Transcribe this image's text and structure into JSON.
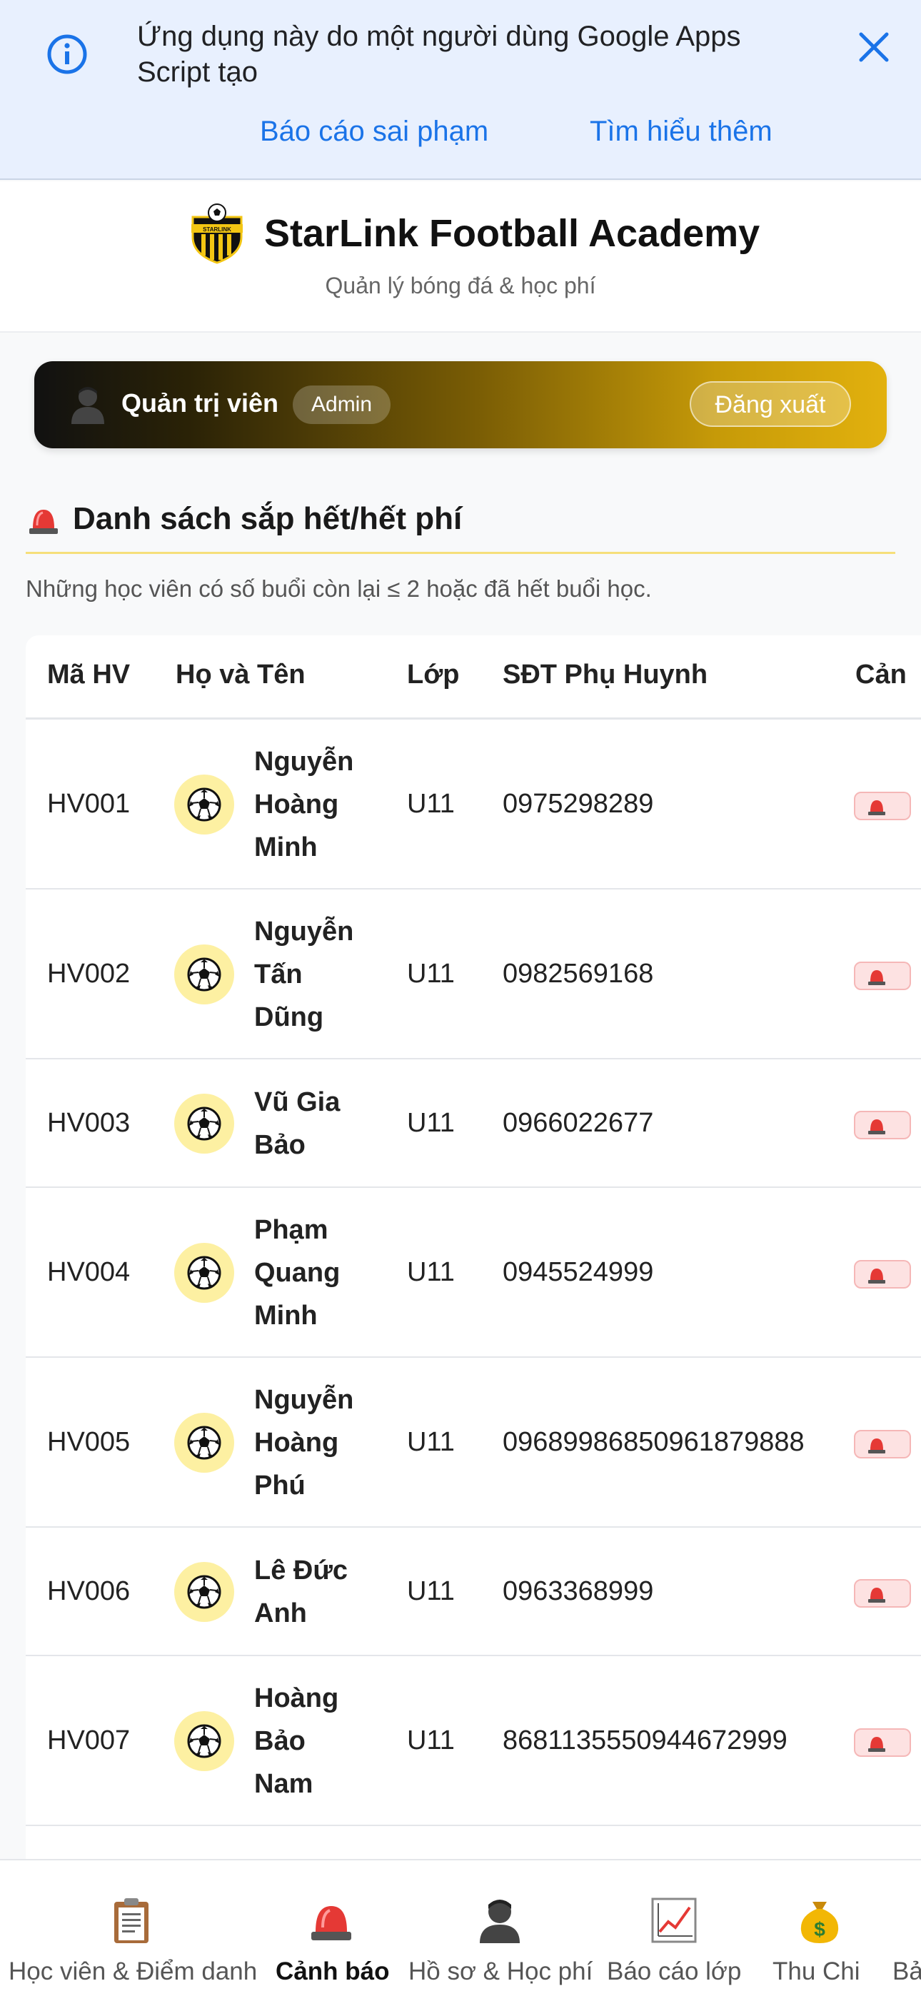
{
  "banner": {
    "text": "Ứng dụng này do một người dùng Google Apps Script tạo",
    "report_link": "Báo cáo sai phạm",
    "learn_link": "Tìm hiểu thêm",
    "info_icon": "info-icon",
    "close_icon": "close-icon",
    "accent": "#1a73e8"
  },
  "header": {
    "logo_text": "STARLINK",
    "title": "StarLink Football Academy",
    "subtitle": "Quản lý bóng đá & học phí"
  },
  "admin": {
    "name": "Quản trị viên",
    "role": "Admin",
    "logout": "Đăng xuất",
    "gradient_end": "#e2b10e"
  },
  "section": {
    "title": "Danh sách sắp hết/hết phí",
    "description": "Những học viên có số buổi còn lại ≤ 2 hoặc đã hết buổi học."
  },
  "table": {
    "columns": [
      "Mã HV",
      "Họ và Tên",
      "Lớp",
      "SĐT Phụ Huynh",
      "Cản"
    ],
    "rows": [
      {
        "id": "HV001",
        "name": [
          "Nguyễn",
          "Hoàng",
          "Minh"
        ],
        "class": "U11",
        "phone": "0975298289"
      },
      {
        "id": "HV002",
        "name": [
          "Nguyễn",
          "Tấn",
          "Dũng"
        ],
        "class": "U11",
        "phone": "0982569168"
      },
      {
        "id": "HV003",
        "name": [
          "Vũ Gia",
          "Bảo"
        ],
        "class": "U11",
        "phone": "0966022677"
      },
      {
        "id": "HV004",
        "name": [
          "Phạm",
          "Quang",
          "Minh"
        ],
        "class": "U11",
        "phone": "0945524999"
      },
      {
        "id": "HV005",
        "name": [
          "Nguyễn",
          "Hoàng",
          "Phú"
        ],
        "class": "U11",
        "phone": "0968998685​0961879888"
      },
      {
        "id": "HV006",
        "name": [
          "Lê Đức",
          "Anh"
        ],
        "class": "U11",
        "phone": "0963368999"
      },
      {
        "id": "HV007",
        "name": [
          "Hoàng",
          "Bảo",
          "Nam"
        ],
        "class": "U11",
        "phone": "8681135550944672999"
      }
    ]
  },
  "nav": {
    "items": [
      {
        "label": "Học viên & Điểm danh",
        "icon": "clipboard-icon",
        "active": false
      },
      {
        "label": "Cảnh báo",
        "icon": "siren-icon",
        "active": true
      },
      {
        "label": "Hồ sơ & Học phí",
        "icon": "user-silhouette-icon",
        "active": false
      },
      {
        "label": "Báo cáo lớp",
        "icon": "chart-icon",
        "active": false
      },
      {
        "label": "Thu Chi",
        "icon": "money-bag-icon",
        "active": false
      },
      {
        "label": "Bả",
        "icon": "",
        "active": false
      }
    ]
  }
}
